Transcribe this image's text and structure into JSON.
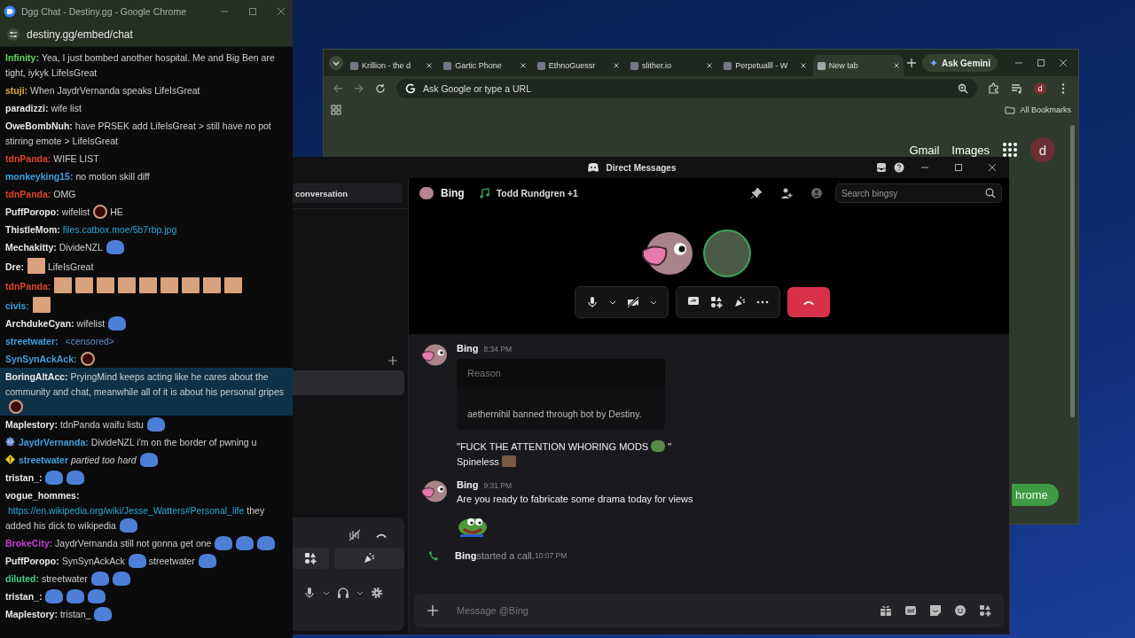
{
  "chat_window": {
    "title": "Dgg Chat - Destiny.gg - Google Chrome",
    "url": "destiny.gg/embed/chat",
    "messages": [
      {
        "user": "Infinity:",
        "color": "#5fd35f",
        "highlighted": false,
        "parts": [
          {
            "kind": "text",
            "text": "Yea, I just bombed another hospital. Me and Big Ben are tight, iykyk LifeIsGreat"
          }
        ]
      },
      {
        "user": "stuji:",
        "color": "#e5a83a",
        "highlighted": false,
        "parts": [
          {
            "kind": "text",
            "text": "When JaydrVernanda speaks LifeIsGreat"
          }
        ]
      },
      {
        "user": "paradizzi:",
        "color": "#e8e8e8",
        "highlighted": false,
        "parts": [
          {
            "kind": "text",
            "text": "wife list"
          }
        ]
      },
      {
        "user": "OweBombNuh:",
        "color": "#e8e8e8",
        "highlighted": false,
        "parts": [
          {
            "kind": "text",
            "text": "have PRSEK add LifeIsGreat > still have no pot stirring emote > LifeIsGreat"
          }
        ]
      },
      {
        "user": "tdnPanda:",
        "color": "#e0442c",
        "highlighted": false,
        "parts": [
          {
            "kind": "text",
            "text": "WIFE LIST"
          }
        ]
      },
      {
        "user": "monkeyking15:",
        "color": "#3ea0e0",
        "highlighted": false,
        "parts": [
          {
            "kind": "text",
            "text": "no motion skill diff"
          }
        ]
      },
      {
        "user": "tdnPanda:",
        "color": "#e0442c",
        "highlighted": false,
        "parts": [
          {
            "kind": "text",
            "text": "OMG"
          }
        ]
      },
      {
        "user": "PuffPoropo:",
        "color": "#e8e8e8",
        "highlighted": false,
        "parts": [
          {
            "kind": "text",
            "text": "wifelist"
          },
          {
            "kind": "ring"
          },
          {
            "kind": "text",
            "text": "HE"
          }
        ]
      },
      {
        "user": "ThistleMom:",
        "color": "#e8e8e8",
        "highlighted": false,
        "parts": [
          {
            "kind": "link",
            "text": "files.catbox.moe/5b7rbp.jpg"
          }
        ]
      },
      {
        "user": "Mechakitty:",
        "color": "#e8e8e8",
        "highlighted": false,
        "parts": [
          {
            "kind": "text",
            "text": "DivideNZL"
          },
          {
            "kind": "blob"
          }
        ]
      },
      {
        "user": "Dre:",
        "color": "#e8e8e8",
        "highlighted": false,
        "parts": [
          {
            "kind": "picture"
          },
          {
            "kind": "text",
            "text": "LifeIsGreat"
          }
        ]
      },
      {
        "user": "tdnPanda:",
        "color": "#e0442c",
        "highlighted": false,
        "parts": [
          {
            "kind": "picture"
          },
          {
            "kind": "picture"
          },
          {
            "kind": "picture"
          },
          {
            "kind": "picture"
          },
          {
            "kind": "picture"
          },
          {
            "kind": "picture"
          },
          {
            "kind": "picture"
          },
          {
            "kind": "picture"
          },
          {
            "kind": "picture"
          }
        ]
      },
      {
        "user": "civis:",
        "color": "#3ea0e0",
        "highlighted": false,
        "parts": [
          {
            "kind": "picture"
          }
        ]
      },
      {
        "user": "ArchdukeCyan:",
        "color": "#e8e8e8",
        "highlighted": false,
        "parts": [
          {
            "kind": "text",
            "text": "wifelist"
          },
          {
            "kind": "blob"
          }
        ]
      },
      {
        "user": "streetwater:",
        "color": "#3ea0e0",
        "highlighted": false,
        "parts": [
          {
            "kind": "censored",
            "text": "<censored>"
          }
        ]
      },
      {
        "user": "SynSynAckAck:",
        "color": "#3ea0e0",
        "highlighted": false,
        "parts": [
          {
            "kind": "ring"
          }
        ]
      },
      {
        "user": "BoringAltAcc:",
        "color": "#e8e8e8",
        "highlighted": true,
        "parts": [
          {
            "kind": "text",
            "text": "PryingMind keeps acting like he cares about the community and chat, meanwhile all of it is about his personal gripes"
          },
          {
            "kind": "ring"
          }
        ]
      },
      {
        "user": "Maplestory:",
        "color": "#e8e8e8",
        "highlighted": false,
        "parts": [
          {
            "kind": "text",
            "text": "tdnPanda waifu listu"
          },
          {
            "kind": "blob"
          }
        ]
      },
      {
        "user": "JaydrVernanda:",
        "color": "#3ea0e0",
        "badges": [
          {
            "kind": "code"
          }
        ],
        "highlighted": false,
        "parts": [
          {
            "kind": "text",
            "text": "DivideNZL i'm on the border of pwning u"
          }
        ]
      },
      {
        "user": "streetwater",
        "color": "#3ea0e0",
        "badges": [
          {
            "kind": "diamond"
          }
        ],
        "highlighted": false,
        "parts": [
          {
            "kind": "action",
            "text": "partied too hard"
          },
          {
            "kind": "blob"
          }
        ]
      },
      {
        "user": "tristan_:",
        "color": "#e8e8e8",
        "highlighted": false,
        "parts": [
          {
            "kind": "blob"
          },
          {
            "kind": "blob"
          }
        ]
      },
      {
        "user": "vogue_hommes:",
        "color": "#e8e8e8",
        "highlighted": false,
        "parts": [
          {
            "kind": "link",
            "text": "https://en.wikipedia.org/wiki/Jesse_Watters#Personal_life"
          },
          {
            "kind": "text",
            "text": "they added his dick to wikipedia"
          },
          {
            "kind": "blob"
          }
        ]
      },
      {
        "user": "BrokeCity:",
        "color": "#c93cd8",
        "highlighted": false,
        "parts": [
          {
            "kind": "text",
            "text": "JaydrVernanda still not gonna get one"
          },
          {
            "kind": "blob"
          },
          {
            "kind": "blob"
          },
          {
            "kind": "blob"
          }
        ]
      },
      {
        "user": "PuffPoropo:",
        "color": "#e8e8e8",
        "highlighted": false,
        "parts": [
          {
            "kind": "text",
            "text": "SynSynAckAck"
          },
          {
            "kind": "blob"
          },
          {
            "kind": "text",
            "text": "streetwater"
          },
          {
            "kind": "blob"
          }
        ]
      },
      {
        "user": "diluted:",
        "color": "#3fd08a",
        "highlighted": false,
        "parts": [
          {
            "kind": "text",
            "text": "streetwater"
          },
          {
            "kind": "blob"
          },
          {
            "kind": "blob"
          }
        ]
      },
      {
        "user": "tristan_:",
        "color": "#e8e8e8",
        "highlighted": false,
        "parts": [
          {
            "kind": "blob"
          },
          {
            "kind": "blob"
          },
          {
            "kind": "blob"
          }
        ]
      },
      {
        "user": "Maplestory:",
        "color": "#e8e8e8",
        "highlighted": false,
        "parts": [
          {
            "kind": "text",
            "text": "tristan_"
          },
          {
            "kind": "blob"
          }
        ]
      }
    ]
  },
  "browser_window": {
    "tabs": [
      {
        "title": "Krillion - the d",
        "selected": false
      },
      {
        "title": "Gartic Phone",
        "selected": false
      },
      {
        "title": "EthnoGuessr",
        "selected": false
      },
      {
        "title": "slither.io",
        "selected": false
      },
      {
        "title": "Perpetualll - W",
        "selected": false
      },
      {
        "title": "New tab",
        "selected": true
      }
    ],
    "gemini_button": "Ask Gemini",
    "omnibox_placeholder": "Ask Google or type a URL",
    "profile_initial": "d",
    "bookmarks_label": "All Bookmarks",
    "page_links": [
      "Gmail",
      "Images"
    ],
    "page_profile_initial": "d",
    "page_button": "hrome"
  },
  "discord_window": {
    "title": "Direct Messages",
    "sidebar": {
      "search_button": "conversation"
    },
    "header": {
      "name": "Bing",
      "activity": "Todd Rundgren +1",
      "search_placeholder": "Search bingsy"
    },
    "messages": [
      {
        "kind": "group",
        "author": "Bing",
        "time": "8:34 PM",
        "embed": {
          "title": "Reason",
          "body": "aethernihil banned through bot by Destiny."
        },
        "lines": [
          [
            {
              "kind": "text",
              "text": "\"FUCK THE ATTENTION WHORING MODS"
            },
            {
              "kind": "blob"
            },
            {
              "kind": "text",
              "text": "\""
            }
          ],
          [
            {
              "kind": "text",
              "text": "Spineless"
            },
            {
              "kind": "picture"
            }
          ]
        ]
      },
      {
        "kind": "group",
        "author": "Bing",
        "time": "9:31 PM",
        "lines": [
          [
            {
              "kind": "text",
              "text": "Are you ready to fabricate some drama today for views"
            }
          ],
          [
            {
              "kind": "jumbo"
            }
          ]
        ]
      },
      {
        "kind": "call",
        "author": "Bing",
        "text": "started a call.",
        "time": "10:07 PM"
      }
    ],
    "input_placeholder": "Message @Bing"
  }
}
